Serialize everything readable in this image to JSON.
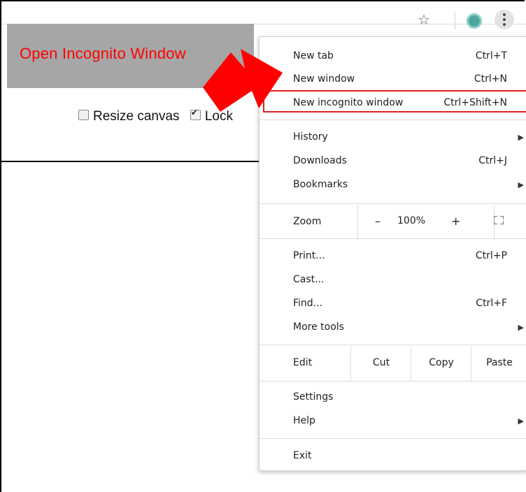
{
  "banner": {
    "text": "Open Incognito Window"
  },
  "controls": {
    "resize_label": "Resize canvas",
    "lock_label": "Lock"
  },
  "toolbar": {
    "star_icon": "star-outline",
    "menu_icon": "kebab-vertical"
  },
  "menu": {
    "items_top": [
      {
        "label": "New tab",
        "shortcut": "Ctrl+T"
      },
      {
        "label": "New window",
        "shortcut": "Ctrl+N"
      },
      {
        "label": "New incognito window",
        "shortcut": "Ctrl+Shift+N"
      }
    ],
    "items_mid": [
      {
        "label": "History",
        "submenu": true
      },
      {
        "label": "Downloads",
        "shortcut": "Ctrl+J"
      },
      {
        "label": "Bookmarks",
        "submenu": true
      }
    ],
    "zoom": {
      "label": "Zoom",
      "minus": "–",
      "value": "100%",
      "plus": "+"
    },
    "items_tools": [
      {
        "label": "Print...",
        "shortcut": "Ctrl+P"
      },
      {
        "label": "Cast..."
      },
      {
        "label": "Find...",
        "shortcut": "Ctrl+F"
      },
      {
        "label": "More tools",
        "submenu": true
      }
    ],
    "edit": {
      "label": "Edit",
      "cut": "Cut",
      "copy": "Copy",
      "paste": "Paste"
    },
    "items_settings": [
      {
        "label": "Settings"
      },
      {
        "label": "Help",
        "submenu": true
      }
    ],
    "exit": {
      "label": "Exit"
    }
  },
  "colors": {
    "highlight": "#e02020",
    "arrow": "#ff0000",
    "banner_bg": "#a6a6a6",
    "banner_text": "#ff0000"
  }
}
